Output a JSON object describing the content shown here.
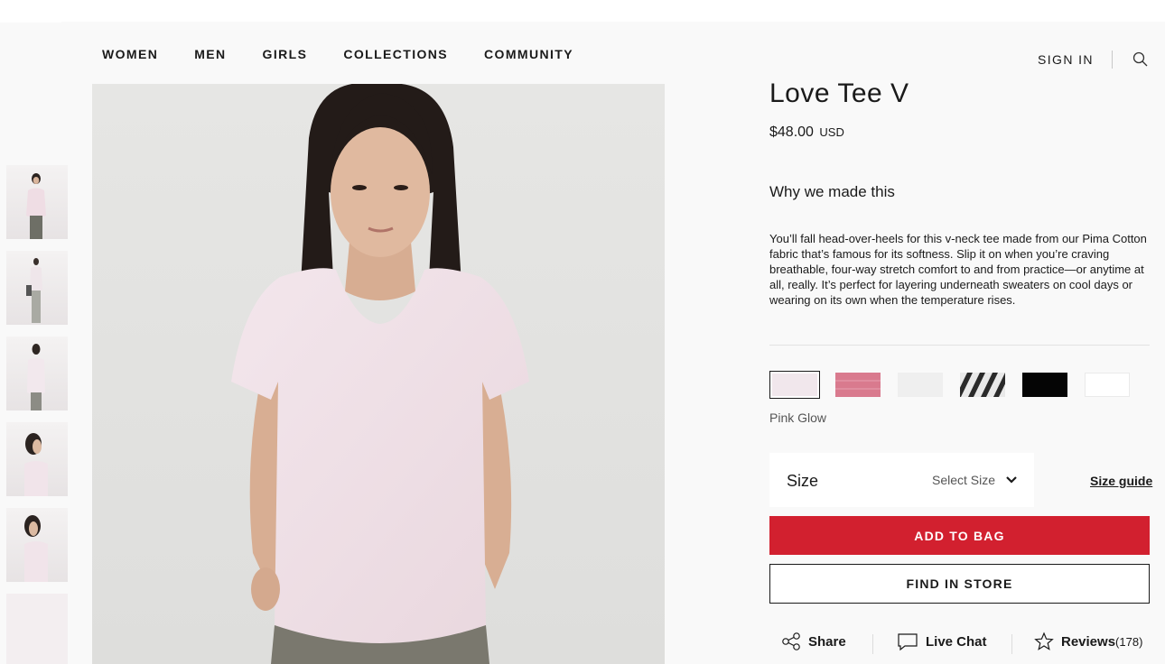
{
  "nav": {
    "items": [
      {
        "label": "WOMEN"
      },
      {
        "label": "MEN"
      },
      {
        "label": "GIRLS"
      },
      {
        "label": "COLLECTIONS"
      },
      {
        "label": "COMMUNITY"
      }
    ],
    "sign_in": "SIGN IN",
    "search_icon": "search-icon"
  },
  "product": {
    "title": "Love Tee V",
    "price": "$48.00",
    "currency": "USD",
    "why_heading": "Why we made this",
    "description": "You’ll fall head-over-heels for this v-neck tee made from our Pima Cotton fabric that’s famous for its softness. Slip it on when you’re craving breathable, four-way stretch comfort to and from practice—or anytime at all, really. It’s perfect for layering underneath sweaters on cool days or wearing on its own when the temperature rises.",
    "colors": [
      {
        "name": "Pink Glow",
        "hex": "#f1e7ec",
        "selected": true
      },
      {
        "name": "rose",
        "hex": "#d97a8e"
      },
      {
        "name": "heathered white",
        "hex": "#efefef"
      },
      {
        "name": "stripe",
        "hex": "#2a2a2a"
      },
      {
        "name": "black",
        "hex": "#050505"
      },
      {
        "name": "white",
        "hex": "#ffffff"
      }
    ],
    "selected_color": "Pink Glow",
    "size": {
      "label": "Size",
      "placeholder": "Select Size",
      "guide": "Size guide"
    },
    "add_to_bag": "ADD TO BAG",
    "find_in_store": "FIND IN STORE"
  },
  "actions": {
    "share": "Share",
    "live_chat": "Live Chat",
    "reviews": "Reviews",
    "reviews_count": "(178)"
  },
  "gallery": {
    "thumbnail_count": 6
  },
  "colors": {
    "accent": "#d2202f",
    "page_bg": "#f9f9f9",
    "text": "#1a1a1a"
  }
}
